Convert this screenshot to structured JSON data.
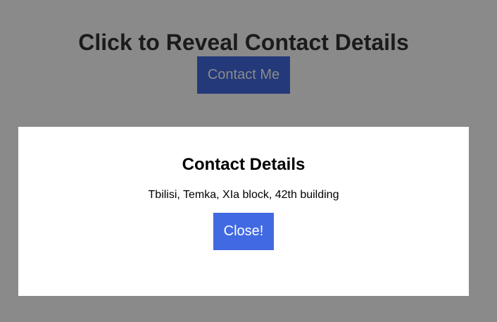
{
  "page": {
    "title": "Click to Reveal Contact Details",
    "contact_button_label": "Contact Me"
  },
  "modal": {
    "title": "Contact Details",
    "address": "Tbilisi, Temka, XIa block, 42th building",
    "close_button_label": "Close!"
  },
  "colors": {
    "accent": "#4169e1",
    "overlay": "rgba(0,0,0,0.46)",
    "modal_background": "#ffffff"
  }
}
